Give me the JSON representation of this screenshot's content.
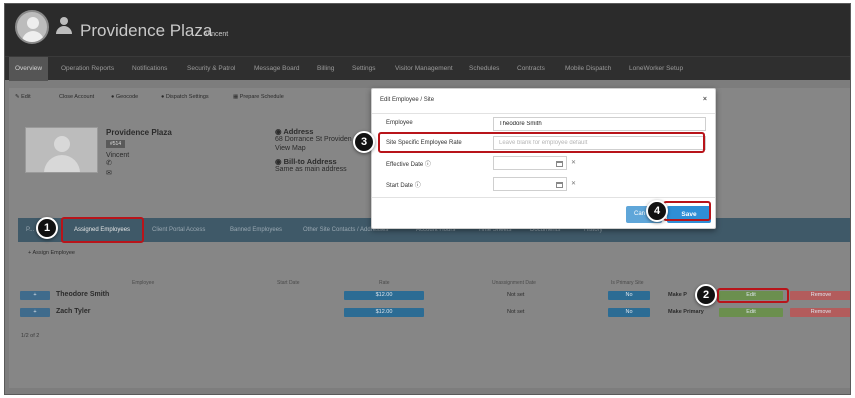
{
  "header": {
    "title": "Providence Plaza",
    "subtitle": "Vincent"
  },
  "nav": [
    "Overview",
    "Operation Reports",
    "Notifications",
    "Security & Patrol",
    "Message Board",
    "Billing",
    "Settings",
    "Visitor Management",
    "Schedules",
    "Contracts",
    "Mobile Dispatch",
    "LoneWorker Setup"
  ],
  "toolbar": [
    "Edit",
    "Close Account",
    "Geocode",
    "Dispatch Settings",
    "Prepare Schedule"
  ],
  "profile": {
    "name": "Providence Plaza",
    "badge": "#514",
    "subtitle": "Vincent",
    "address_heading": "Address",
    "address_line": "68 Dorrance St Providen",
    "view_map": "View Map",
    "billto_heading": "Bill-to Address",
    "billto_line": "Same as main address"
  },
  "tabs": [
    "P...",
    "Assigned Employees",
    "Client Portal Access",
    "Banned Employees",
    "Other Site Contacts / Addresses",
    "Account Hours",
    "Time Sheets",
    "Documents",
    "History"
  ],
  "assign_label": "Assign Employee",
  "table": {
    "headers": [
      "Employee",
      "Start Date",
      "Rate",
      "Unassignment Date",
      "Is Primary Site"
    ],
    "rows": [
      {
        "name": "Theodore Smith",
        "rate": "$12.00",
        "unassign": "Not set",
        "primary": "No",
        "make_primary": "Make P",
        "edit": "Edit",
        "remove": "Remove"
      },
      {
        "name": "Zach Tyler",
        "rate": "$12.00",
        "unassign": "Not set",
        "primary": "No",
        "make_primary": "Make Primary",
        "edit": "Edit",
        "remove": "Remove"
      }
    ]
  },
  "pager": "1/2 of 2",
  "modal": {
    "title": "Edit Employee / Site",
    "close": "×",
    "employee_label": "Employee",
    "employee_value": "Theodore Smith",
    "rate_label": "Site Specific Employee Rate",
    "rate_placeholder": "Leave blank for employee default",
    "effective_label": "Effective Date",
    "start_label": "Start Date",
    "cancel": "Can",
    "save": "Save"
  },
  "steps": [
    "1",
    "2",
    "3",
    "4"
  ]
}
